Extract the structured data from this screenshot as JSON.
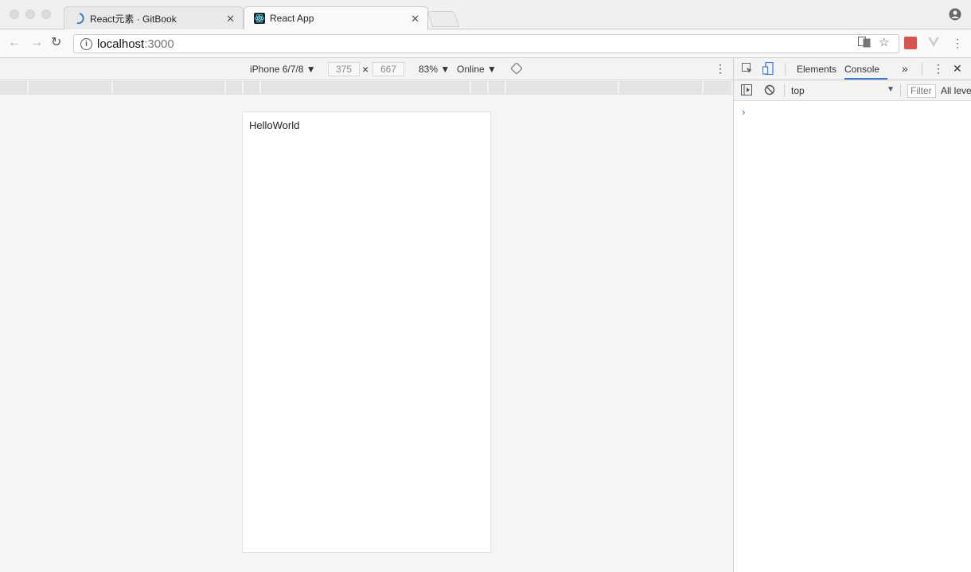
{
  "browser": {
    "tabs": [
      {
        "title": "React元素 · GitBook",
        "active": false
      },
      {
        "title": "React App",
        "active": true
      }
    ],
    "address": {
      "host": "localhost",
      "port": ":3000"
    }
  },
  "device_toolbar": {
    "device": "iPhone 6/7/8 ▼",
    "width": "375",
    "times": "×",
    "height": "667",
    "zoom": "83% ▼",
    "network": "Online ▼"
  },
  "page": {
    "text": "HelloWorld"
  },
  "devtools": {
    "tabs": [
      "Elements",
      "Console"
    ],
    "active_tab": "Console",
    "more": "»",
    "context": "top",
    "filter_placeholder": "Filter",
    "levels": "All leve",
    "prompt": "›"
  },
  "colors": {
    "accent": "#3879d9"
  }
}
